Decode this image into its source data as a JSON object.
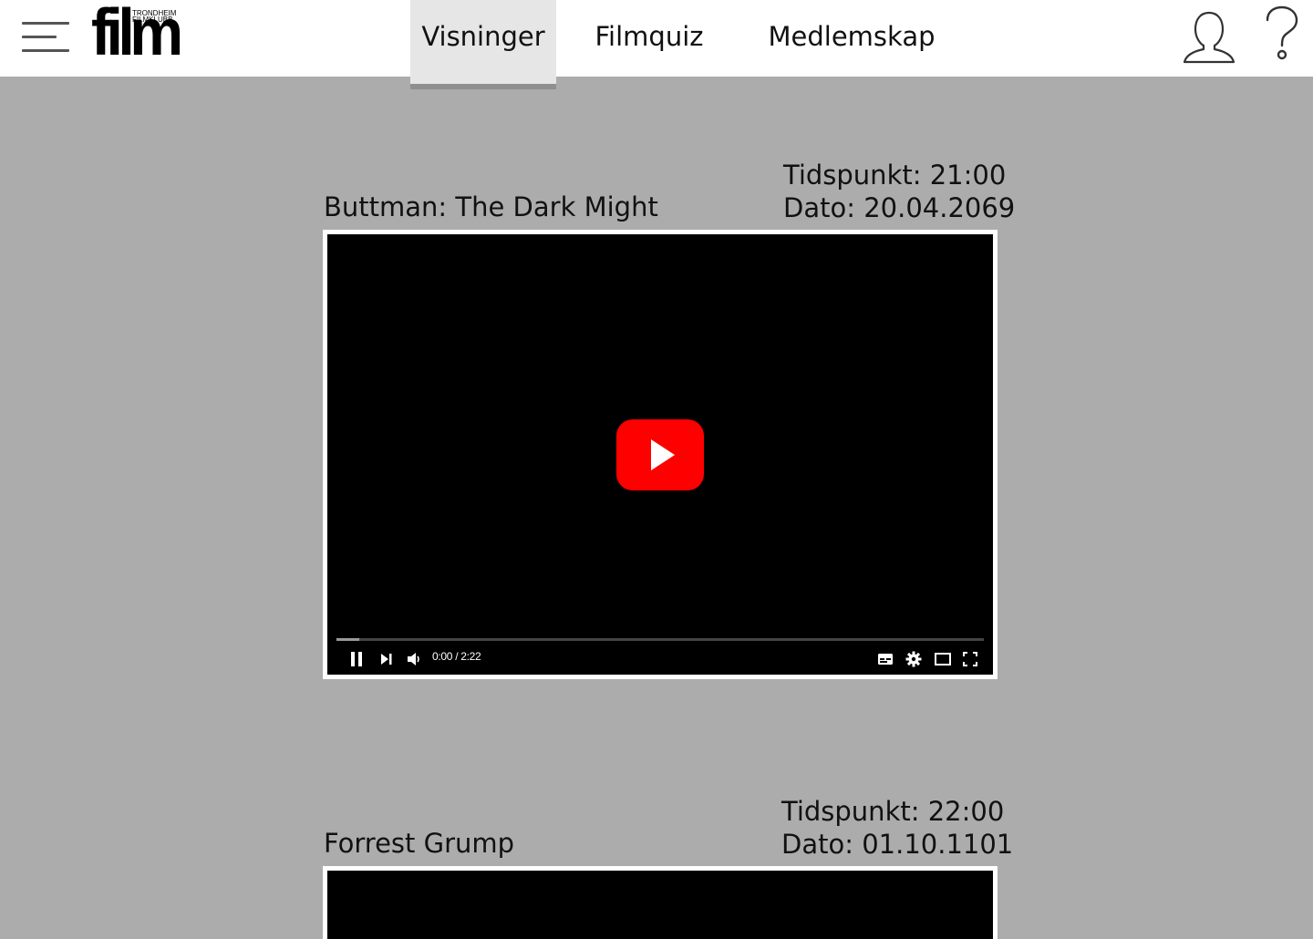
{
  "header": {
    "logo": {
      "word": "film",
      "line1": "TRONDHEIM",
      "line2": "FILMKLUBB"
    },
    "nav": [
      {
        "label": "Visninger",
        "active": true
      },
      {
        "label": "Filmquiz",
        "active": false
      },
      {
        "label": "Medlemskap",
        "active": false
      }
    ],
    "icons": {
      "menu": "menu-icon",
      "user": "user-icon",
      "help": "help-icon"
    }
  },
  "screenings": [
    {
      "title": "Buttman: The Dark Might",
      "time": "Tidspunkt: 21:00",
      "date": "Dato: 20.04.2069",
      "player": {
        "time": "0:00 / 2:22",
        "progress": 0.035
      }
    },
    {
      "title": "Forrest Grump",
      "time": "Tidspunkt: 22:00",
      "date": "Dato: 01.10.1101"
    }
  ],
  "colors": {
    "background": "#acacac",
    "header": "#ffffff",
    "active_tab": "#e6e6e6",
    "play_button": "#ff0000"
  }
}
